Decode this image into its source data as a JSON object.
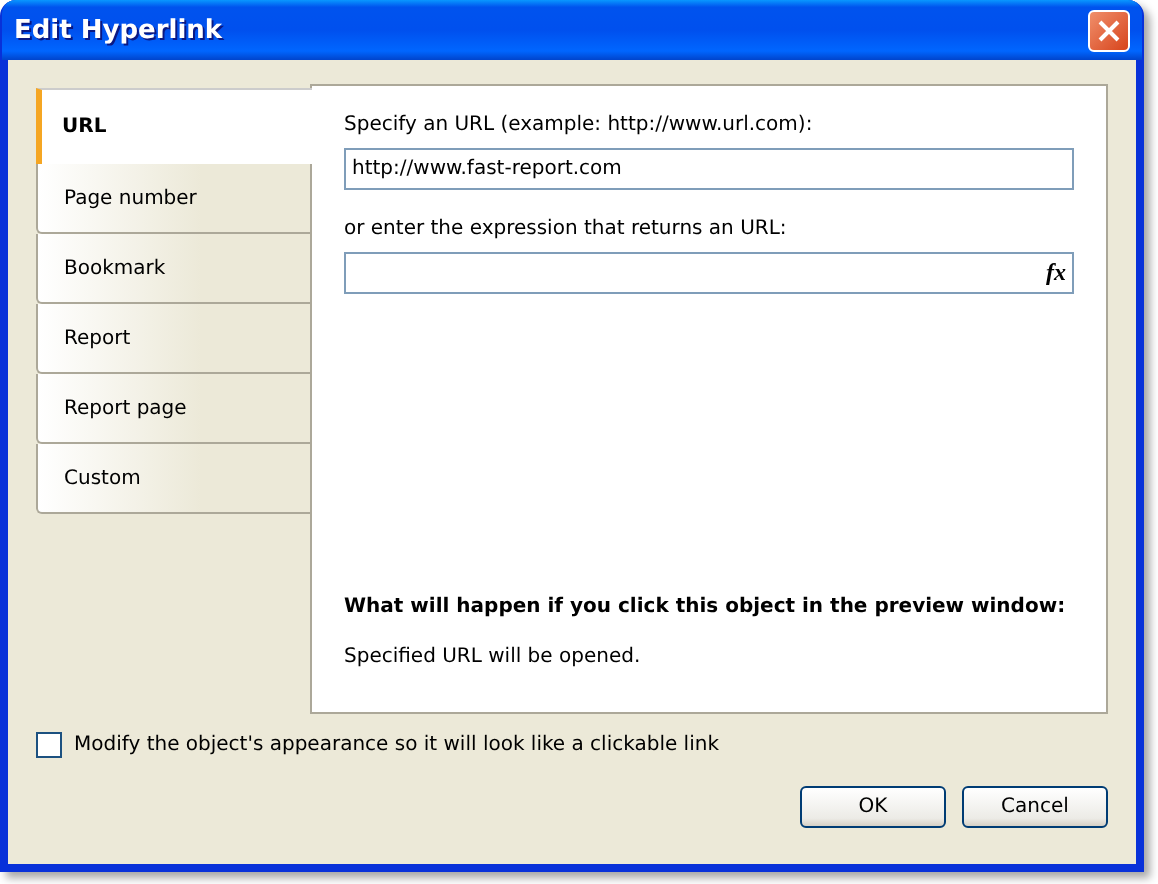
{
  "window": {
    "title": "Edit Hyperlink"
  },
  "tabs": [
    {
      "label": "URL",
      "selected": true
    },
    {
      "label": "Page number",
      "selected": false
    },
    {
      "label": "Bookmark",
      "selected": false
    },
    {
      "label": "Report",
      "selected": false
    },
    {
      "label": "Report page",
      "selected": false
    },
    {
      "label": "Custom",
      "selected": false
    }
  ],
  "url_label": "Specify an URL (example: http://www.url.com):",
  "url_field": {
    "value": "http://www.fast-report.com"
  },
  "expression_label": "or enter the expression that returns an URL:",
  "expression_field": {
    "button": "fx"
  },
  "info": {
    "heading": "What will happen if you click this object in the preview window:",
    "text": "Specified URL will be opened."
  },
  "modify_checkbox": {
    "label": "Modify the object's appearance so it will look like a clickable link",
    "checked": false
  },
  "buttons": [
    "OK",
    "Cancel"
  ]
}
